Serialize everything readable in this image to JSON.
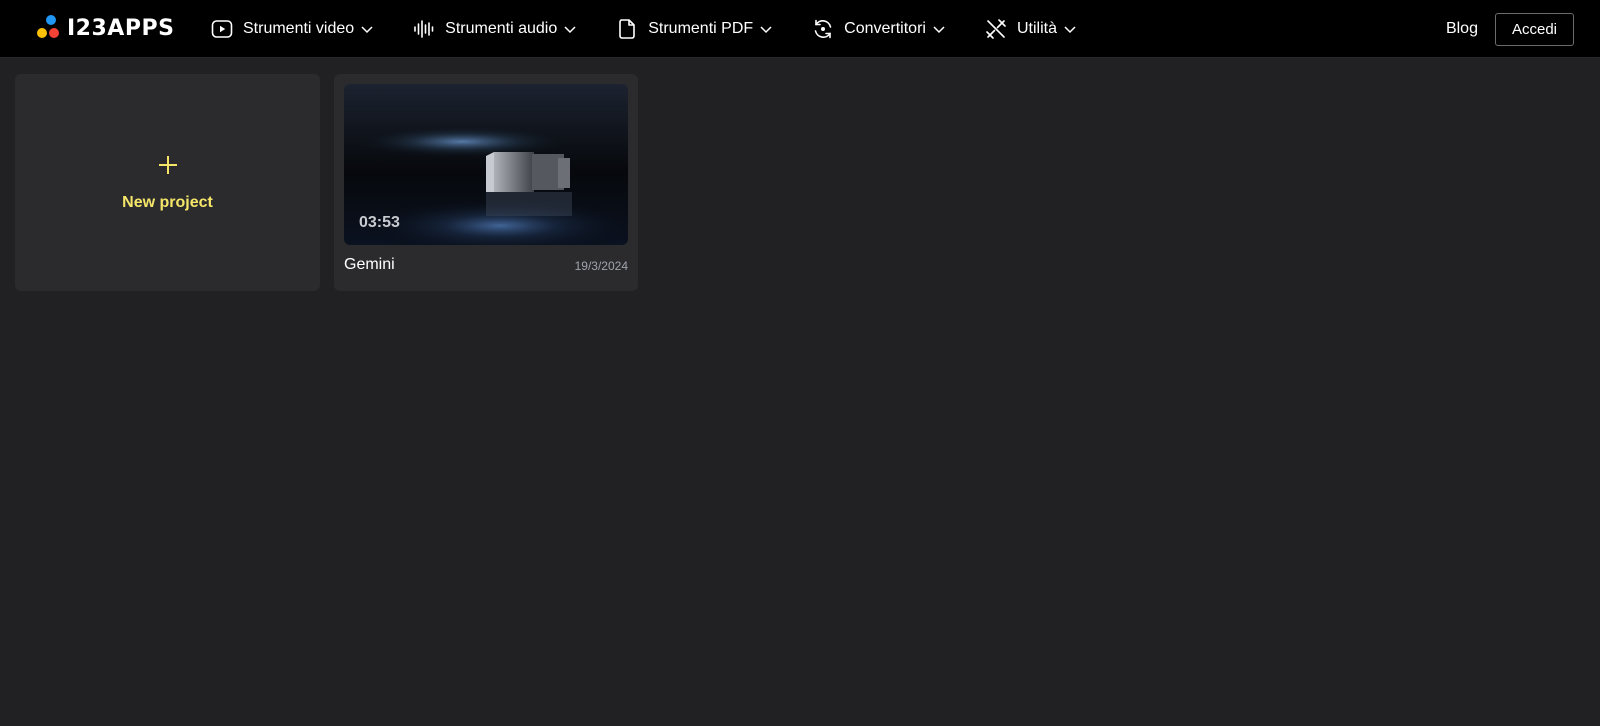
{
  "app": {
    "logo_text": "I23APPS",
    "logo_colors": [
      "#2196f3",
      "#ffc107",
      "#f44336"
    ]
  },
  "nav": {
    "items": [
      {
        "label": "Strumenti video",
        "icon": "play-icon"
      },
      {
        "label": "Strumenti audio",
        "icon": "waveform-icon"
      },
      {
        "label": "Strumenti PDF",
        "icon": "document-icon"
      },
      {
        "label": "Convertitori",
        "icon": "convert-icon"
      },
      {
        "label": "Utilità",
        "icon": "tools-icon"
      }
    ],
    "blog_label": "Blog",
    "login_label": "Accedi"
  },
  "projects": {
    "new_label": "New project",
    "new_accent": "#f5e66a",
    "items": [
      {
        "name": "Gemini",
        "date": "19/3/2024",
        "duration": "03:53"
      }
    ]
  }
}
